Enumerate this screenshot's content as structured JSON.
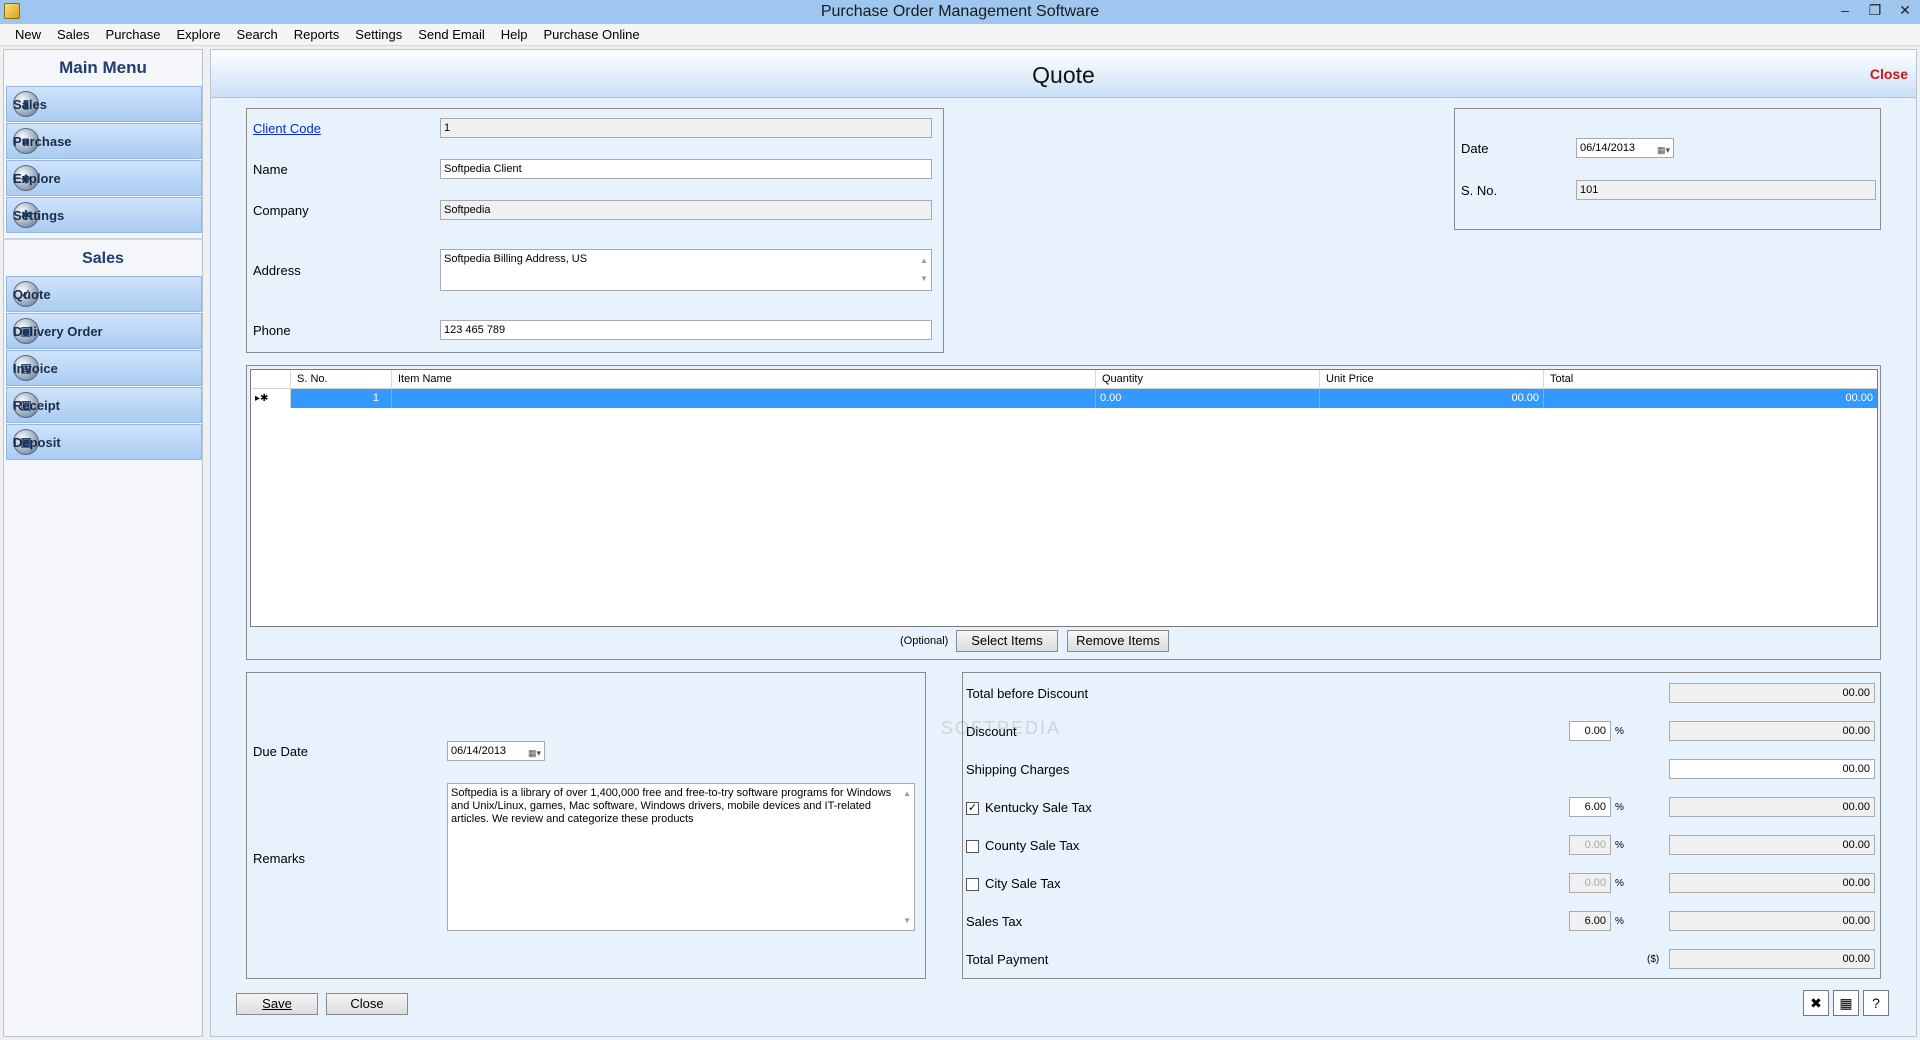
{
  "window": {
    "title": "Purchase Order Management Software",
    "controls": [
      "–",
      "❐",
      "✕"
    ]
  },
  "menu": [
    "New",
    "Sales",
    "Purchase",
    "Explore",
    "Search",
    "Reports",
    "Settings",
    "Send Email",
    "Help",
    "Purchase Online"
  ],
  "sidebar": {
    "main_menu_title": "Main Menu",
    "main_items": [
      {
        "label": "Sales",
        "icon": "sales-chart-icon"
      },
      {
        "label": "Purchase",
        "icon": "purchase-box-icon"
      },
      {
        "label": "Explore",
        "icon": "explore-icon"
      },
      {
        "label": "Settings",
        "icon": "settings-gear-icon"
      }
    ],
    "section_title": "Sales",
    "section_items": [
      {
        "label": "Quote",
        "icon": "quote-check-icon"
      },
      {
        "label": "Delivery Order",
        "icon": "delivery-order-icon"
      },
      {
        "label": "Invoice",
        "icon": "invoice-icon"
      },
      {
        "label": "Receipt",
        "icon": "receipt-icon"
      },
      {
        "label": "Deposit",
        "icon": "deposit-icon"
      }
    ]
  },
  "page": {
    "title": "Quote",
    "close_link": "Close"
  },
  "client": {
    "client_code_label": "Client Code",
    "client_code": "1",
    "name_label": "Name",
    "name": "Softpedia Client",
    "company_label": "Company",
    "company": "Softpedia",
    "address_label": "Address",
    "address": "Softpedia Billing Address, US",
    "phone_label": "Phone",
    "phone": "123 465 789"
  },
  "meta": {
    "date_label": "Date",
    "date": "06/14/2013",
    "sno_label": "S. No.",
    "sno": "101"
  },
  "grid": {
    "columns": [
      "S. No.",
      "Item Name",
      "Quantity",
      "Unit Price",
      "Total"
    ],
    "row_header": "▸✱",
    "rows": [
      {
        "sno": "1",
        "item": "",
        "qty": "0.00",
        "unit_price": "00.00",
        "total": "00.00"
      }
    ]
  },
  "item_actions": {
    "optional": "(Optional)",
    "select_items": "Select Items",
    "remove_items": "Remove Items"
  },
  "footer_left": {
    "due_date_label": "Due Date",
    "due_date": "06/14/2013",
    "remarks_label": "Remarks",
    "remarks": "Softpedia is a library of over 1,400,000 free and free-to-try software programs for Windows and Unix/Linux, games, Mac software, Windows drivers, mobile devices and IT-related articles. We review and categorize these products"
  },
  "totals": {
    "total_before_discount_label": "Total before Discount",
    "total_before_discount": "00.00",
    "discount_label": "Discount",
    "discount_pct": "0.00",
    "discount_amount": "00.00",
    "shipping_label": "Shipping Charges",
    "shipping": "00.00",
    "kentucky_label": "Kentucky Sale Tax",
    "kentucky_checked": true,
    "kentucky_pct": "6.00",
    "kentucky_amount": "00.00",
    "county_label": "County Sale Tax",
    "county_checked": false,
    "county_pct": "0.00",
    "county_amount": "00.00",
    "city_label": "City Sale Tax",
    "city_checked": false,
    "city_pct": "0.00",
    "city_amount": "00.00",
    "sales_tax_label": "Sales Tax",
    "sales_tax_pct": "6.00",
    "sales_tax_amount": "00.00",
    "total_payment_label": "Total Payment",
    "currency": "($)",
    "total_payment": "00.00",
    "pct_symbol": "%"
  },
  "actions": {
    "save": "Save",
    "close": "Close"
  },
  "watermark": "SOFTPEDIA"
}
